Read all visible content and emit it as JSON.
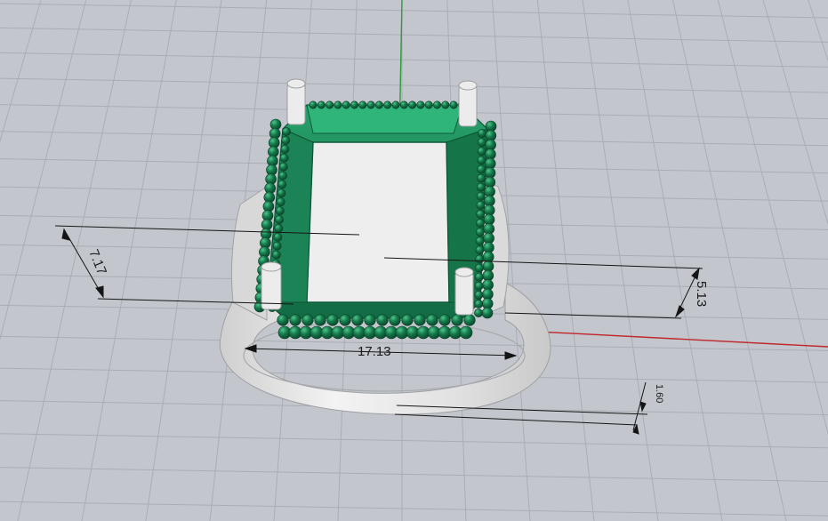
{
  "viewport": {
    "view": "perspective",
    "background_color": "#c3c7cd",
    "grid_color": "#a9adb4",
    "x_axis_color": "#c0262a",
    "y_axis_color": "#2e9a3a"
  },
  "model": {
    "metal_color": "#e7e7e7",
    "stone_color": "#1d8a5b",
    "accent_beads_color": "#0f6b43"
  },
  "dimensions": {
    "height_label": "7.17",
    "depth_label": "5.13",
    "width_label": "17.13",
    "thickness_label": "1.60"
  }
}
